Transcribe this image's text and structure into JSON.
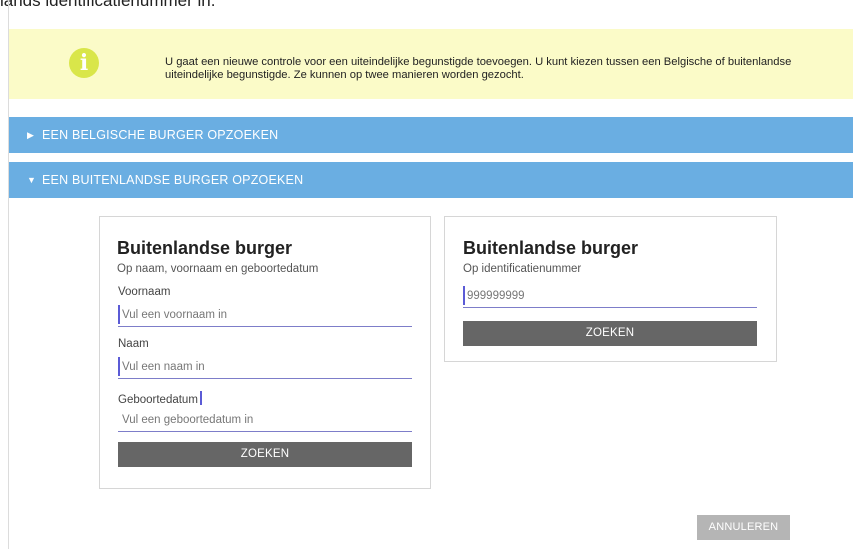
{
  "page": {
    "top_text": "lands identificatienummer in."
  },
  "info": {
    "icon": "info-icon",
    "text": "U gaat een nieuwe controle voor een uiteindelijke begunstigde toevoegen. U kunt kiezen tussen een Belgische of buitenlandse uiteindelijke begunstigde. Ze kunnen op twee manieren worden gezocht."
  },
  "accordions": [
    {
      "label": "EEN BELGISCHE BURGER OPZOEKEN",
      "state": "collapsed",
      "icon": "caret-right-icon"
    },
    {
      "label": "EEN BUITENLANDSE BURGER OPZOEKEN",
      "state": "expanded",
      "icon": "caret-down-icon"
    }
  ],
  "card_name": {
    "title": "Buitenlandse burger",
    "subtitle": "Op naam, voornaam en geboortedatum",
    "firstname_label": "Voornaam",
    "firstname_placeholder": "Vul een voornaam in",
    "lastname_label": "Naam",
    "lastname_placeholder": "Vul een naam in",
    "birthdate_label": "Geboortedatum",
    "birthdate_placeholder": "Vul een geboortedatum in",
    "search_label": "ZOEKEN"
  },
  "card_id": {
    "title": "Buitenlandse burger",
    "subtitle": "Op identificatienummer",
    "id_placeholder": "999999999",
    "search_label": "ZOEKEN"
  },
  "footer": {
    "cancel_label": "ANNULEREN"
  },
  "colors": {
    "banner_bg": "#fbfbc8",
    "info_icon": "#d9e64a",
    "accordion_bg": "#6aaee2",
    "button_dark": "#666666",
    "button_disabled": "#b5b5b5",
    "input_focus": "#5b5bd6"
  }
}
